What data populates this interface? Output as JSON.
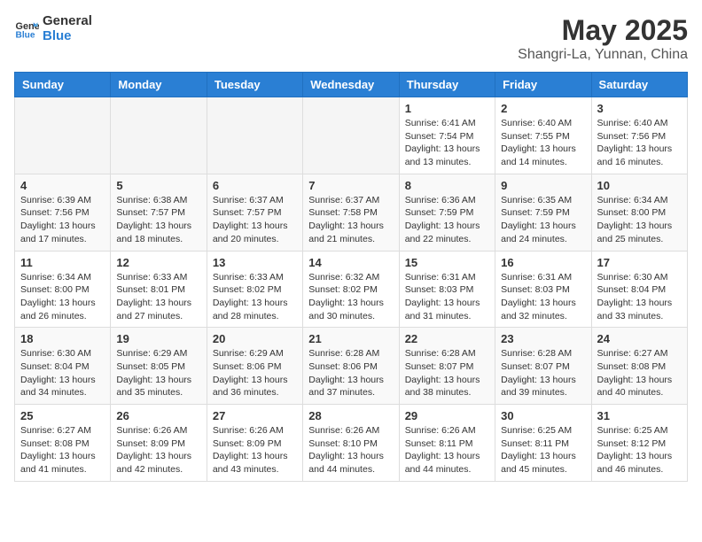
{
  "header": {
    "logo_line1": "General",
    "logo_line2": "Blue",
    "month_year": "May 2025",
    "location": "Shangri-La, Yunnan, China"
  },
  "weekdays": [
    "Sunday",
    "Monday",
    "Tuesday",
    "Wednesday",
    "Thursday",
    "Friday",
    "Saturday"
  ],
  "weeks": [
    [
      {
        "day": "",
        "info": ""
      },
      {
        "day": "",
        "info": ""
      },
      {
        "day": "",
        "info": ""
      },
      {
        "day": "",
        "info": ""
      },
      {
        "day": "1",
        "info": "Sunrise: 6:41 AM\nSunset: 7:54 PM\nDaylight: 13 hours\nand 13 minutes."
      },
      {
        "day": "2",
        "info": "Sunrise: 6:40 AM\nSunset: 7:55 PM\nDaylight: 13 hours\nand 14 minutes."
      },
      {
        "day": "3",
        "info": "Sunrise: 6:40 AM\nSunset: 7:56 PM\nDaylight: 13 hours\nand 16 minutes."
      }
    ],
    [
      {
        "day": "4",
        "info": "Sunrise: 6:39 AM\nSunset: 7:56 PM\nDaylight: 13 hours\nand 17 minutes."
      },
      {
        "day": "5",
        "info": "Sunrise: 6:38 AM\nSunset: 7:57 PM\nDaylight: 13 hours\nand 18 minutes."
      },
      {
        "day": "6",
        "info": "Sunrise: 6:37 AM\nSunset: 7:57 PM\nDaylight: 13 hours\nand 20 minutes."
      },
      {
        "day": "7",
        "info": "Sunrise: 6:37 AM\nSunset: 7:58 PM\nDaylight: 13 hours\nand 21 minutes."
      },
      {
        "day": "8",
        "info": "Sunrise: 6:36 AM\nSunset: 7:59 PM\nDaylight: 13 hours\nand 22 minutes."
      },
      {
        "day": "9",
        "info": "Sunrise: 6:35 AM\nSunset: 7:59 PM\nDaylight: 13 hours\nand 24 minutes."
      },
      {
        "day": "10",
        "info": "Sunrise: 6:34 AM\nSunset: 8:00 PM\nDaylight: 13 hours\nand 25 minutes."
      }
    ],
    [
      {
        "day": "11",
        "info": "Sunrise: 6:34 AM\nSunset: 8:00 PM\nDaylight: 13 hours\nand 26 minutes."
      },
      {
        "day": "12",
        "info": "Sunrise: 6:33 AM\nSunset: 8:01 PM\nDaylight: 13 hours\nand 27 minutes."
      },
      {
        "day": "13",
        "info": "Sunrise: 6:33 AM\nSunset: 8:02 PM\nDaylight: 13 hours\nand 28 minutes."
      },
      {
        "day": "14",
        "info": "Sunrise: 6:32 AM\nSunset: 8:02 PM\nDaylight: 13 hours\nand 30 minutes."
      },
      {
        "day": "15",
        "info": "Sunrise: 6:31 AM\nSunset: 8:03 PM\nDaylight: 13 hours\nand 31 minutes."
      },
      {
        "day": "16",
        "info": "Sunrise: 6:31 AM\nSunset: 8:03 PM\nDaylight: 13 hours\nand 32 minutes."
      },
      {
        "day": "17",
        "info": "Sunrise: 6:30 AM\nSunset: 8:04 PM\nDaylight: 13 hours\nand 33 minutes."
      }
    ],
    [
      {
        "day": "18",
        "info": "Sunrise: 6:30 AM\nSunset: 8:04 PM\nDaylight: 13 hours\nand 34 minutes."
      },
      {
        "day": "19",
        "info": "Sunrise: 6:29 AM\nSunset: 8:05 PM\nDaylight: 13 hours\nand 35 minutes."
      },
      {
        "day": "20",
        "info": "Sunrise: 6:29 AM\nSunset: 8:06 PM\nDaylight: 13 hours\nand 36 minutes."
      },
      {
        "day": "21",
        "info": "Sunrise: 6:28 AM\nSunset: 8:06 PM\nDaylight: 13 hours\nand 37 minutes."
      },
      {
        "day": "22",
        "info": "Sunrise: 6:28 AM\nSunset: 8:07 PM\nDaylight: 13 hours\nand 38 minutes."
      },
      {
        "day": "23",
        "info": "Sunrise: 6:28 AM\nSunset: 8:07 PM\nDaylight: 13 hours\nand 39 minutes."
      },
      {
        "day": "24",
        "info": "Sunrise: 6:27 AM\nSunset: 8:08 PM\nDaylight: 13 hours\nand 40 minutes."
      }
    ],
    [
      {
        "day": "25",
        "info": "Sunrise: 6:27 AM\nSunset: 8:08 PM\nDaylight: 13 hours\nand 41 minutes."
      },
      {
        "day": "26",
        "info": "Sunrise: 6:26 AM\nSunset: 8:09 PM\nDaylight: 13 hours\nand 42 minutes."
      },
      {
        "day": "27",
        "info": "Sunrise: 6:26 AM\nSunset: 8:09 PM\nDaylight: 13 hours\nand 43 minutes."
      },
      {
        "day": "28",
        "info": "Sunrise: 6:26 AM\nSunset: 8:10 PM\nDaylight: 13 hours\nand 44 minutes."
      },
      {
        "day": "29",
        "info": "Sunrise: 6:26 AM\nSunset: 8:11 PM\nDaylight: 13 hours\nand 44 minutes."
      },
      {
        "day": "30",
        "info": "Sunrise: 6:25 AM\nSunset: 8:11 PM\nDaylight: 13 hours\nand 45 minutes."
      },
      {
        "day": "31",
        "info": "Sunrise: 6:25 AM\nSunset: 8:12 PM\nDaylight: 13 hours\nand 46 minutes."
      }
    ]
  ]
}
